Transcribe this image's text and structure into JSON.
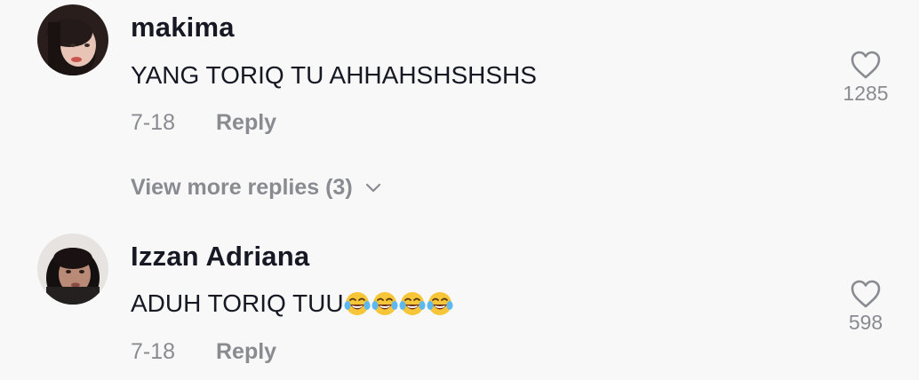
{
  "comments": [
    {
      "username": "makima",
      "text": "YANG TORIQ TU AHHAHSHSHSHS",
      "date": "7-18",
      "reply_label": "Reply",
      "like_count": "1285",
      "view_more_label": "View more replies (3)"
    },
    {
      "username": "Izzan Adriana",
      "text": "ADUH TORIQ TUU",
      "emoji_name": "face-with-tears-of-joy",
      "emoji_count": 4,
      "date": "7-18",
      "reply_label": "Reply",
      "like_count": "598"
    }
  ],
  "icons": {
    "like": "heart-outline-icon",
    "expand": "chevron-down-icon"
  }
}
